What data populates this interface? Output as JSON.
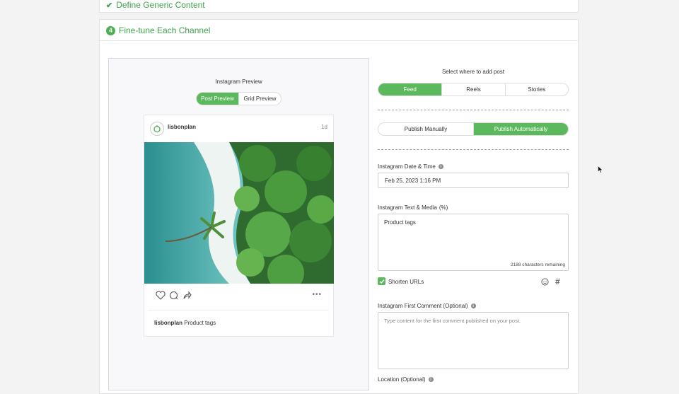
{
  "sections": {
    "prev_title": "Define Generic Content",
    "step_number": "4",
    "title": "Fine-tune Each Channel"
  },
  "preview": {
    "title": "Instagram Preview",
    "tabs": [
      "Post Preview",
      "Grid Preview"
    ],
    "active_tab": "Post Preview",
    "post": {
      "username": "lisbonplan",
      "time": "1d",
      "caption_user": "lisbonplan",
      "caption_text": "Product tags"
    }
  },
  "settings": {
    "where_label": "Select where to add post",
    "where_options": [
      "Feed",
      "Reels",
      "Stories"
    ],
    "where_selected": "Feed",
    "publish_options": [
      "Publish Manually",
      "Publish Automatically"
    ],
    "publish_selected": "Publish Automatically",
    "date_label": "Instagram Date & Time",
    "date_value": "Feb 25, 2023 1:16 PM",
    "text_label": "Instagram Text & Media",
    "text_label_suffix": "(%)",
    "text_value": "Product tags",
    "chars_remaining": "2188 characters remaining",
    "shorten_urls_label": "Shorten URLs",
    "shorten_urls_checked": true,
    "first_comment_label": "Instagram First Comment (Optional)",
    "first_comment_placeholder": "Type content for the first comment published on your post.",
    "location_label": "Location (Optional)"
  },
  "colors": {
    "accent": "#5cb85c",
    "accent_text": "#3ea24d"
  }
}
